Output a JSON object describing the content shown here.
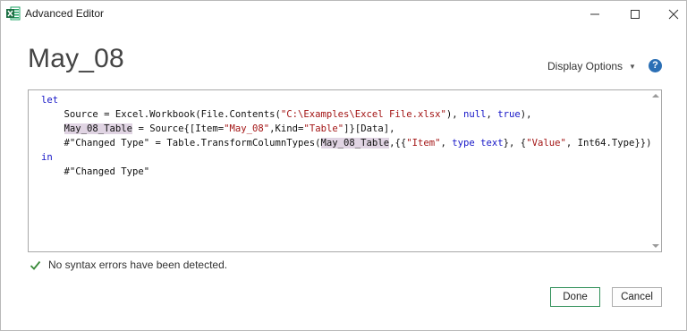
{
  "window": {
    "title": "Advanced Editor",
    "controls": [
      "minimize",
      "maximize",
      "close"
    ]
  },
  "header": {
    "query_name": "May_08",
    "display_options_label": "Display Options",
    "help_label": "?"
  },
  "editor": {
    "lines": [
      [
        {
          "t": "let",
          "c": "kw"
        }
      ],
      [
        {
          "t": "    Source = Excel.Workbook(File.Contents("
        },
        {
          "t": "\"C:\\Examples\\Excel File.xlsx\"",
          "c": "str"
        },
        {
          "t": "), "
        },
        {
          "t": "null",
          "c": "kw"
        },
        {
          "t": ", "
        },
        {
          "t": "true",
          "c": "kw"
        },
        {
          "t": "),"
        }
      ],
      [
        {
          "t": "    "
        },
        {
          "t": "May_08_Table",
          "c": "hl"
        },
        {
          "t": " = Source{[Item="
        },
        {
          "t": "\"May_08\"",
          "c": "str"
        },
        {
          "t": ",Kind="
        },
        {
          "t": "\"Table\"",
          "c": "str"
        },
        {
          "t": "]}[Data],"
        }
      ],
      [
        {
          "t": "    #\"Changed Type\" = Table.TransformColumnTypes("
        },
        {
          "t": "May_08_Table",
          "c": "hl"
        },
        {
          "t": ",{{"
        },
        {
          "t": "\"Item\"",
          "c": "str"
        },
        {
          "t": ", "
        },
        {
          "t": "type text",
          "c": "kw"
        },
        {
          "t": "}, {"
        },
        {
          "t": "\"Value\"",
          "c": "str"
        },
        {
          "t": ", Int64.Type}})"
        }
      ],
      [
        {
          "t": "in",
          "c": "kw"
        }
      ],
      [
        {
          "t": "    #\"Changed Type\""
        }
      ]
    ]
  },
  "status": {
    "message": "No syntax errors have been detected.",
    "icon": "checkmark-icon"
  },
  "footer": {
    "done_label": "Done",
    "cancel_label": "Cancel"
  },
  "colors": {
    "keyword": "#1515c7",
    "string": "#a31515",
    "highlight": "#e0d4e3",
    "check": "#3a8a3a",
    "help": "#2b6fb5"
  }
}
